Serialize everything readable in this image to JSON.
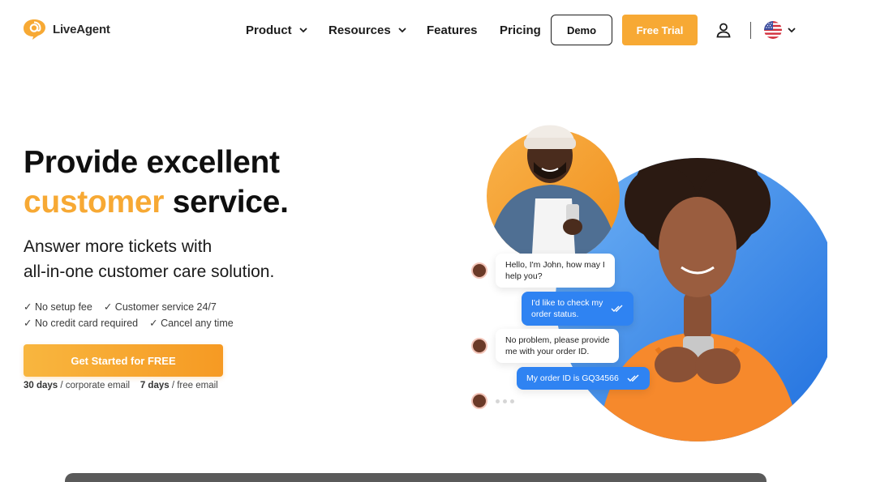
{
  "brand": {
    "name": "LiveAgent",
    "accent": "#f7a934",
    "blue": "#2f83f2"
  },
  "nav": {
    "items": [
      {
        "label": "Product",
        "dropdown": true
      },
      {
        "label": "Resources",
        "dropdown": true
      },
      {
        "label": "Features",
        "dropdown": false
      },
      {
        "label": "Pricing",
        "dropdown": false
      }
    ],
    "demo_label": "Demo",
    "trial_label": "Free Trial",
    "user_icon": "user-icon",
    "language_icon": "us-flag-icon"
  },
  "hero": {
    "headline_line1": "Provide excellent",
    "headline_accent": "customer",
    "headline_rest": " service.",
    "subhead_line1": "Answer more tickets with",
    "subhead_line2": "all-in-one customer care solution.",
    "checks": [
      [
        "No setup fee",
        "Customer service 24/7"
      ],
      [
        "No credit card required",
        "Cancel any time"
      ]
    ],
    "cta_label": "Get Started for FREE",
    "trial_corporate_days": "30 days",
    "trial_corporate_text": " / corporate email",
    "trial_free_days": "7 days",
    "trial_free_text": " / free email"
  },
  "chat": [
    {
      "from": "agent",
      "text_line1": "Hello, I'm John, how may I",
      "text_line2": "help you?"
    },
    {
      "from": "customer",
      "text_line1": "I'd like to check my",
      "text_line2": "order status."
    },
    {
      "from": "agent",
      "text_line1": "No problem, please provide",
      "text_line2": "me with your order ID."
    },
    {
      "from": "customer",
      "text_line1": "My order ID is GQ34566",
      "text_line2": ""
    }
  ]
}
